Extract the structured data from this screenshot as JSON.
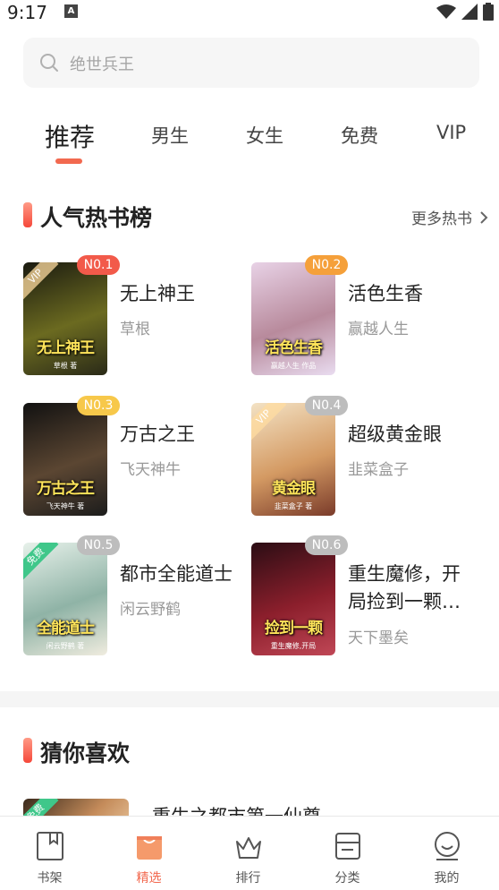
{
  "status": {
    "time": "9:17",
    "badge": "A"
  },
  "search": {
    "placeholder": "绝世兵王"
  },
  "tabs": [
    {
      "label": "推荐",
      "active": true
    },
    {
      "label": "男生"
    },
    {
      "label": "女生"
    },
    {
      "label": "免费"
    },
    {
      "label": "VIP"
    }
  ],
  "hot_section": {
    "title": "人气热书榜",
    "more": "更多热书"
  },
  "books": [
    {
      "rank": "N0.1",
      "title": "无上神王",
      "author": "草根",
      "cover_text": "无上神王",
      "cover_sub": "草根 著",
      "ribbon": "VIP",
      "rank_color": "#f25a4a",
      "cover_colors": [
        "#1a1a10",
        "#6b6a20",
        "#2a2a18"
      ]
    },
    {
      "rank": "N0.2",
      "title": "活色生香",
      "author": "赢越人生",
      "cover_text": "活色生香",
      "cover_sub": "赢越人生 作品",
      "ribbon": "",
      "rank_color": "#f5a03a",
      "cover_colors": [
        "#e8d2e6",
        "#b88a9c",
        "#e9dcf0"
      ]
    },
    {
      "rank": "N0.3",
      "title": "万古之王",
      "author": "飞天神牛",
      "cover_text": "万古之王",
      "cover_sub": "飞天神牛 著",
      "ribbon": "",
      "rank_color": "#f7c84a",
      "cover_colors": [
        "#111111",
        "#5b4632",
        "#1c1c1c"
      ]
    },
    {
      "rank": "N0.4",
      "title": "超级黄金眼",
      "author": "韭菜盒子",
      "cover_text": "黄金眼",
      "cover_sub": "韭菜盒子 著",
      "ribbon": "VIP",
      "rank_color": "#bdbdbd",
      "cover_colors": [
        "#f3e2c4",
        "#d49a63",
        "#7a3b2a"
      ]
    },
    {
      "rank": "N0.5",
      "title": "都市全能道士",
      "author": "闲云野鹤",
      "cover_text": "全能道士",
      "cover_sub": "闲云野鹤 著",
      "ribbon": "免费",
      "rank_color": "#bdbdbd",
      "cover_colors": [
        "#e7f1ea",
        "#8fb3a6",
        "#f0ecdf"
      ]
    },
    {
      "rank": "N0.6",
      "title": "重生魔修，开局捡到一颗…",
      "author": "天下墨矣",
      "cover_text": "捡到一颗",
      "cover_sub": "重生魔修,开局",
      "ribbon": "",
      "rank_color": "#bdbdbd",
      "cover_colors": [
        "#2b0d14",
        "#8c1f2c",
        "#c04756"
      ]
    }
  ],
  "guess_section": {
    "title": "猜你喜欢",
    "first_item": {
      "title": "重生之都市第一仙尊",
      "ribbon": "免费"
    }
  },
  "bottom_nav": [
    {
      "label": "书架",
      "icon": "bookshelf-icon"
    },
    {
      "label": "精选",
      "icon": "featured-bag-icon",
      "active": true
    },
    {
      "label": "排行",
      "icon": "crown-icon"
    },
    {
      "label": "分类",
      "icon": "category-icon"
    },
    {
      "label": "我的",
      "icon": "profile-icon"
    }
  ],
  "colors": {
    "accent": "#f2694f",
    "muted": "#999999"
  }
}
